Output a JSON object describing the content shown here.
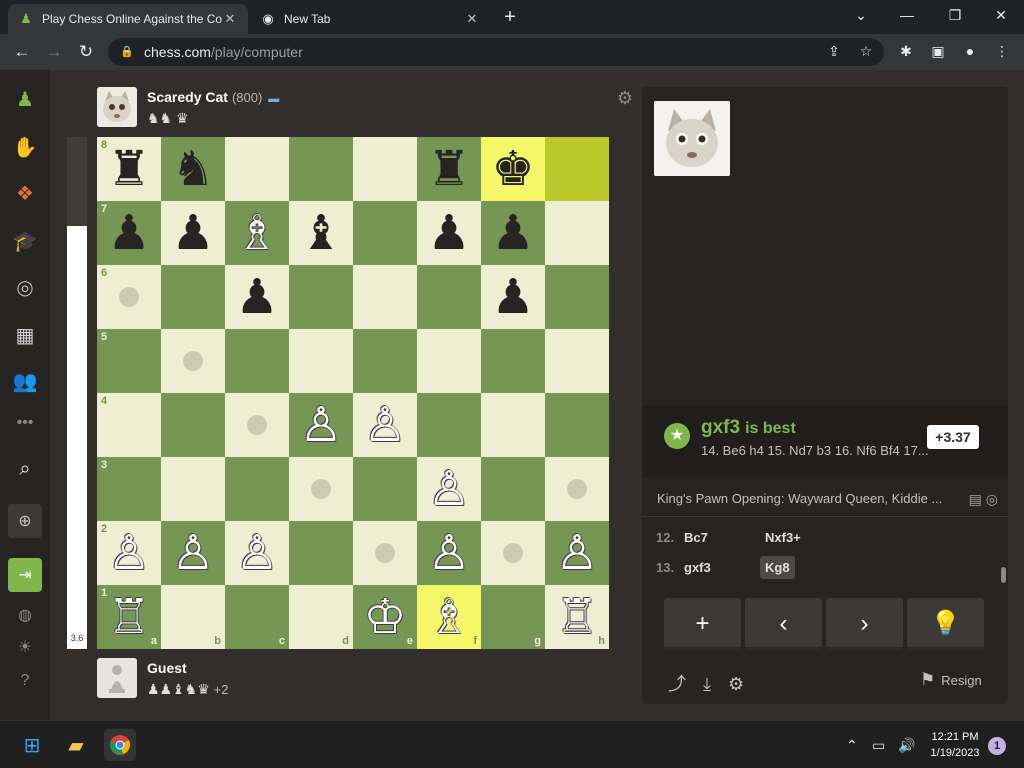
{
  "browser": {
    "tabs": [
      {
        "title": "Play Chess Online Against the Co",
        "icon": "chess-pawn-icon",
        "active": true
      },
      {
        "title": "New Tab",
        "icon": "chrome-icon",
        "active": false
      }
    ],
    "url_host": "chess.com",
    "url_path": "/play/computer"
  },
  "opponent": {
    "name": "Scaredy Cat",
    "rating": "(800)",
    "captured": "♞♞ ♛"
  },
  "player": {
    "name": "Guest",
    "captured": "♟♟♝♞♛",
    "advantage": "+2"
  },
  "evaluation": {
    "label": "3.6",
    "white_fraction": 0.826
  },
  "board": {
    "ranks": [
      "8",
      "7",
      "6",
      "5",
      "4",
      "3",
      "2",
      "1"
    ],
    "files": [
      "a",
      "b",
      "c",
      "d",
      "e",
      "f",
      "g",
      "h"
    ],
    "pieces": [
      {
        "sq": "a8",
        "p": "♜",
        "c": "b"
      },
      {
        "sq": "b8",
        "p": "♞",
        "c": "b"
      },
      {
        "sq": "f8",
        "p": "♜",
        "c": "b"
      },
      {
        "sq": "g8",
        "p": "♚",
        "c": "b"
      },
      {
        "sq": "a7",
        "p": "♟",
        "c": "b"
      },
      {
        "sq": "b7",
        "p": "♟",
        "c": "b"
      },
      {
        "sq": "c7",
        "p": "♗",
        "c": "w"
      },
      {
        "sq": "d7",
        "p": "♝",
        "c": "b"
      },
      {
        "sq": "f7",
        "p": "♟",
        "c": "b"
      },
      {
        "sq": "g7",
        "p": "♟",
        "c": "b"
      },
      {
        "sq": "c6",
        "p": "♟",
        "c": "b"
      },
      {
        "sq": "g6",
        "p": "♟",
        "c": "b"
      },
      {
        "sq": "d4",
        "p": "♙",
        "c": "w"
      },
      {
        "sq": "e4",
        "p": "♙",
        "c": "w"
      },
      {
        "sq": "f3",
        "p": "♙",
        "c": "w"
      },
      {
        "sq": "a2",
        "p": "♙",
        "c": "w"
      },
      {
        "sq": "b2",
        "p": "♙",
        "c": "w"
      },
      {
        "sq": "c2",
        "p": "♙",
        "c": "w"
      },
      {
        "sq": "f2",
        "p": "♙",
        "c": "w"
      },
      {
        "sq": "h2",
        "p": "♙",
        "c": "w"
      },
      {
        "sq": "a1",
        "p": "♖",
        "c": "w"
      },
      {
        "sq": "e1",
        "p": "♔",
        "c": "w"
      },
      {
        "sq": "f1",
        "p": "♗",
        "c": "w"
      },
      {
        "sq": "h1",
        "p": "♖",
        "c": "w"
      }
    ],
    "highlights": [
      "g8",
      "h8",
      "f1"
    ],
    "hints": [
      "a6",
      "b5",
      "c4",
      "d3",
      "e2",
      "g2",
      "h3"
    ]
  },
  "coach": {
    "move": "gxf3",
    "suffix": "is best",
    "line": "14. Be6 h4 15. Nd7 b3 16. Nf6 Bf4 17...",
    "score": "+3.37"
  },
  "opening": "King's Pawn Opening: Wayward Queen, Kiddie ...",
  "moves": [
    {
      "num": "12.",
      "white": "Bc7",
      "black": "Nxf3+"
    },
    {
      "num": "13.",
      "white": "gxf3",
      "black": "Kg8"
    }
  ],
  "controls": {
    "add": "+",
    "prev": "‹",
    "next": "›",
    "hint": "💡"
  },
  "resign_label": "Resign",
  "taskbar": {
    "time": "12:21 PM",
    "date": "1/19/2023",
    "notifications": "1"
  }
}
